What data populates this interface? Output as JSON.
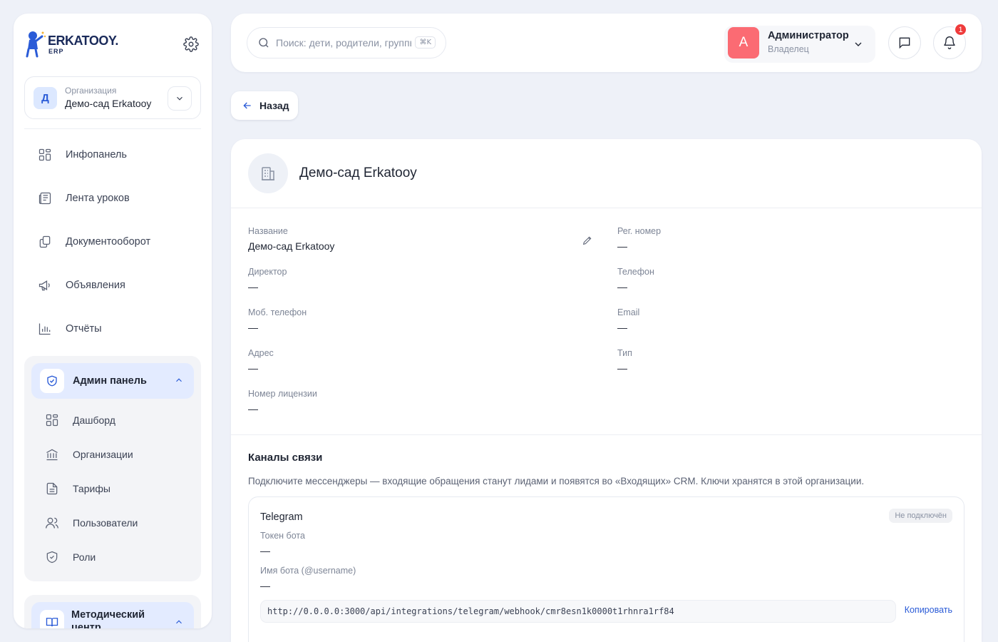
{
  "brand": {
    "name": "ERKATOOY.",
    "sub": "ERP"
  },
  "org": {
    "initial": "Д",
    "label": "Организация",
    "name": "Демо-сад Erkatooy"
  },
  "nav": [
    {
      "label": "Инфопанель",
      "icon": "grid-icon"
    },
    {
      "label": "Лента уроков",
      "icon": "newspaper-icon"
    },
    {
      "label": "Документооборот",
      "icon": "documents-icon"
    },
    {
      "label": "Объявления",
      "icon": "megaphone-icon"
    },
    {
      "label": "Отчёты",
      "icon": "bar-chart-icon"
    }
  ],
  "admin": {
    "title": "Админ панель",
    "items": [
      {
        "label": "Дашборд",
        "icon": "grid-icon"
      },
      {
        "label": "Организации",
        "icon": "bank-icon"
      },
      {
        "label": "Тарифы",
        "icon": "file-text-icon"
      },
      {
        "label": "Пользователи",
        "icon": "users-icon"
      },
      {
        "label": "Роли",
        "icon": "shield-icon"
      }
    ]
  },
  "method": {
    "title": "Методический центр"
  },
  "search": {
    "placeholder": "Поиск: дети, родители, группы",
    "shortcut": "⌘K"
  },
  "user": {
    "initial": "А",
    "name": "Администратор",
    "role": "Владелец"
  },
  "notifications": {
    "count": "1"
  },
  "back": {
    "label": "Назад"
  },
  "org_details": {
    "title": "Демо-сад Erkatooy",
    "fields_left": [
      {
        "label": "Название",
        "value": "Демо-сад Erkatooy"
      },
      {
        "label": "Директор",
        "value": "—"
      },
      {
        "label": "Моб. телефон",
        "value": "—"
      },
      {
        "label": "Адрес",
        "value": "—"
      },
      {
        "label": "Номер лицензии",
        "value": "—"
      }
    ],
    "fields_right": [
      {
        "label": "Рег. номер",
        "value": "—"
      },
      {
        "label": "Телефон",
        "value": "—"
      },
      {
        "label": "Email",
        "value": "—"
      },
      {
        "label": "Тип",
        "value": "—"
      }
    ]
  },
  "channels": {
    "title": "Каналы связи",
    "description": "Подключите мессенджеры — входящие обращения станут лидами и появятся во «Входящих» CRM. Ключи хранятся в этой организации.",
    "telegram": {
      "title": "Telegram",
      "status": "Не подключён",
      "token_label": "Токен бота",
      "token_value": "—",
      "username_label": "Имя бота (@username)",
      "username_value": "—",
      "webhook": "http://0.0.0.0:3000/api/integrations/telegram/webhook/cmr8esn1k0000t1rhnra1rf84",
      "copy_label": "Копировать"
    }
  }
}
